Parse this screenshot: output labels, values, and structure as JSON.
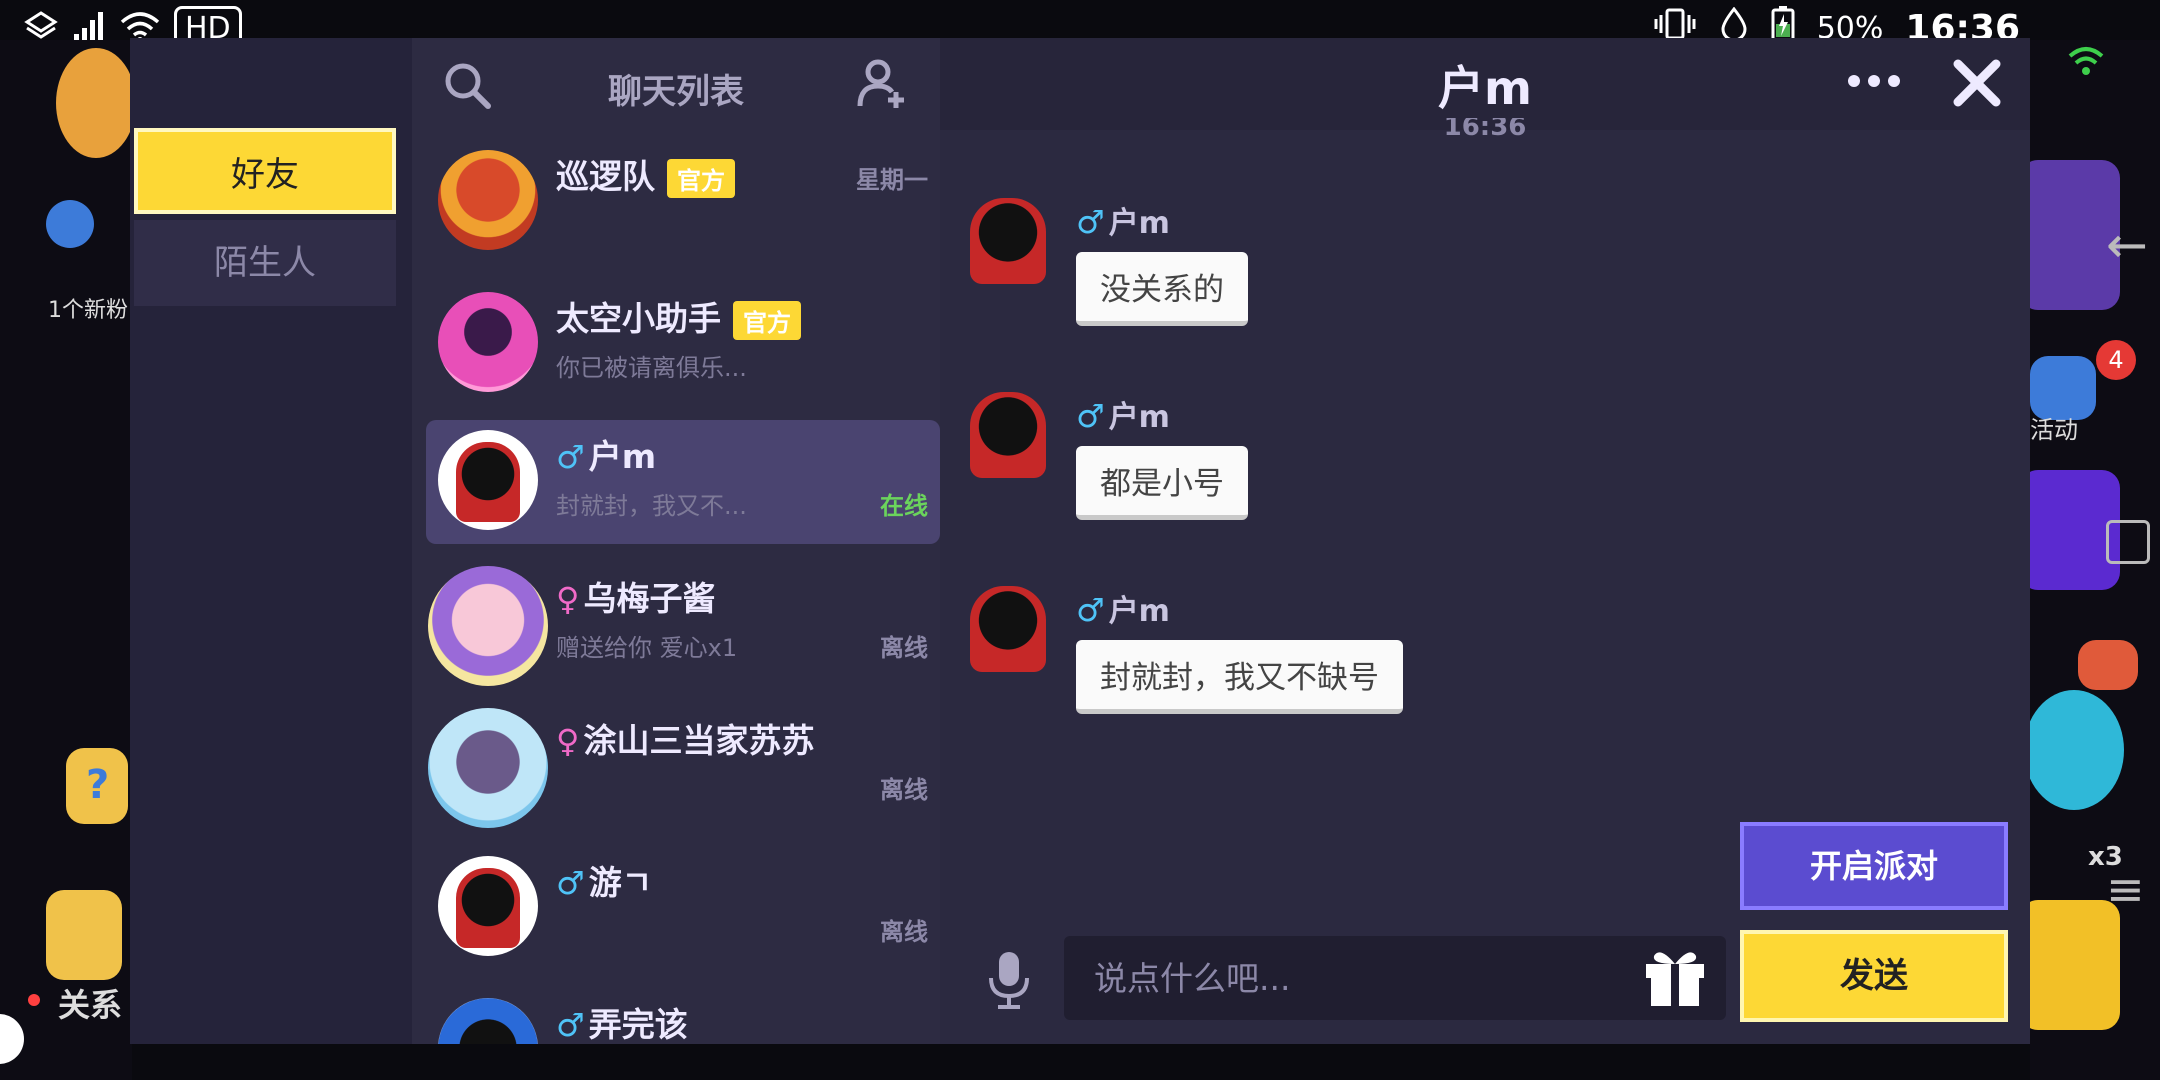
{
  "status_bar": {
    "hd": "HD",
    "battery_pct": "50%",
    "time": "16:36"
  },
  "background": {
    "new_fans": "1个新粉",
    "relation": "关系",
    "activity": "活动",
    "activity_badge": "4",
    "multiplier": "x3"
  },
  "tabs": {
    "friends": "好友",
    "strangers": "陌生人"
  },
  "list": {
    "title": "聊天列表",
    "contacts": [
      {
        "name": "巡逻队",
        "badge": "官方",
        "date": "星期一",
        "preview": "",
        "status": ""
      },
      {
        "name": "太空小助手",
        "badge": "官方",
        "date": "",
        "preview": "你已被请离俱乐...",
        "status": ""
      },
      {
        "name": "户m",
        "gender": "♂",
        "preview": "封就封，我又不...",
        "status": "在线"
      },
      {
        "name": "乌梅子酱",
        "gender": "♀",
        "preview": "赠送给你 爱心x1",
        "status": "离线"
      },
      {
        "name": "涂山三当家苏苏",
        "gender": "♀",
        "preview": "",
        "status": "离线"
      },
      {
        "name": "游ㄱ",
        "gender": "♂",
        "preview": "",
        "status": "离线"
      },
      {
        "name": "弄完该",
        "gender": "♂",
        "preview": "",
        "status": ""
      }
    ]
  },
  "chat": {
    "title": "户m",
    "time": "16:36",
    "messages": [
      {
        "sender": "户m",
        "gender": "♂",
        "text": "没关系的"
      },
      {
        "sender": "户m",
        "gender": "♂",
        "text": "都是小号"
      },
      {
        "sender": "户m",
        "gender": "♂",
        "text": "封就封，我又不缺号"
      }
    ],
    "input_placeholder": "说点什么吧...",
    "party_button": "开启派对",
    "send_button": "发送"
  }
}
